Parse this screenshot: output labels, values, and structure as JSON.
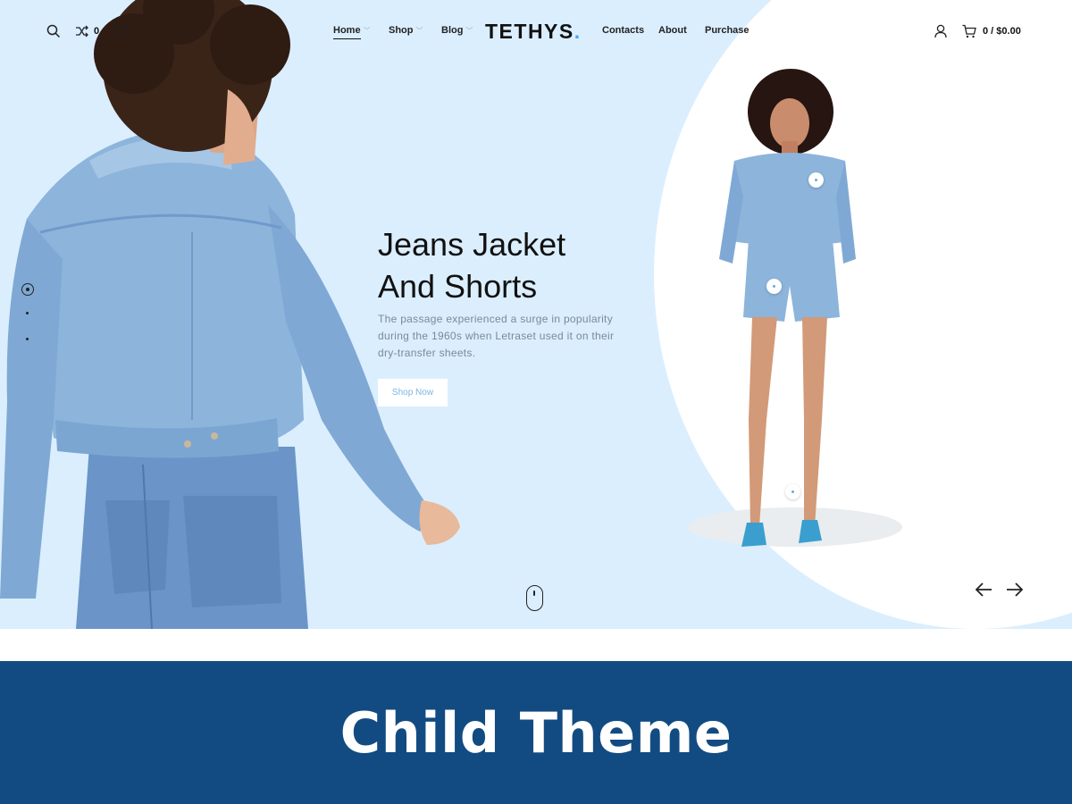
{
  "header": {
    "compare_count": "0",
    "nav": [
      {
        "label": "Home",
        "has_dropdown": true,
        "active": true
      },
      {
        "label": "Shop",
        "has_dropdown": true,
        "active": false
      },
      {
        "label": "Blog",
        "has_dropdown": true,
        "active": false
      },
      {
        "label": "Contacts",
        "has_dropdown": false,
        "active": false
      },
      {
        "label": "About",
        "has_dropdown": false,
        "active": false
      },
      {
        "label": "Purchase",
        "has_dropdown": false,
        "active": false
      }
    ],
    "logo": "TETHYS",
    "logo_dot": ".",
    "cart_text": "0 / $0.00"
  },
  "hero": {
    "title_line1": "Jeans Jacket",
    "title_line2": "And Shorts",
    "description": "The passage experienced a surge in popularity during the 1960s when Letraset used it on their dry-transfer sheets.",
    "button_label": "Shop Now",
    "slide_count": 3,
    "active_slide": 1
  },
  "banner": {
    "text": "Child Theme"
  },
  "colors": {
    "hero_bg": "#dbeefe",
    "banner_bg": "#124b82",
    "accent": "#4aa3f2",
    "button_text": "#7ab6e4",
    "denim": "#8db4db"
  },
  "icons": [
    "search-icon",
    "compare-icon",
    "heart-icon",
    "user-icon",
    "cart-icon",
    "arrow-left-icon",
    "arrow-right-icon",
    "mouse-scroll-icon",
    "chevron-down-icon"
  ]
}
